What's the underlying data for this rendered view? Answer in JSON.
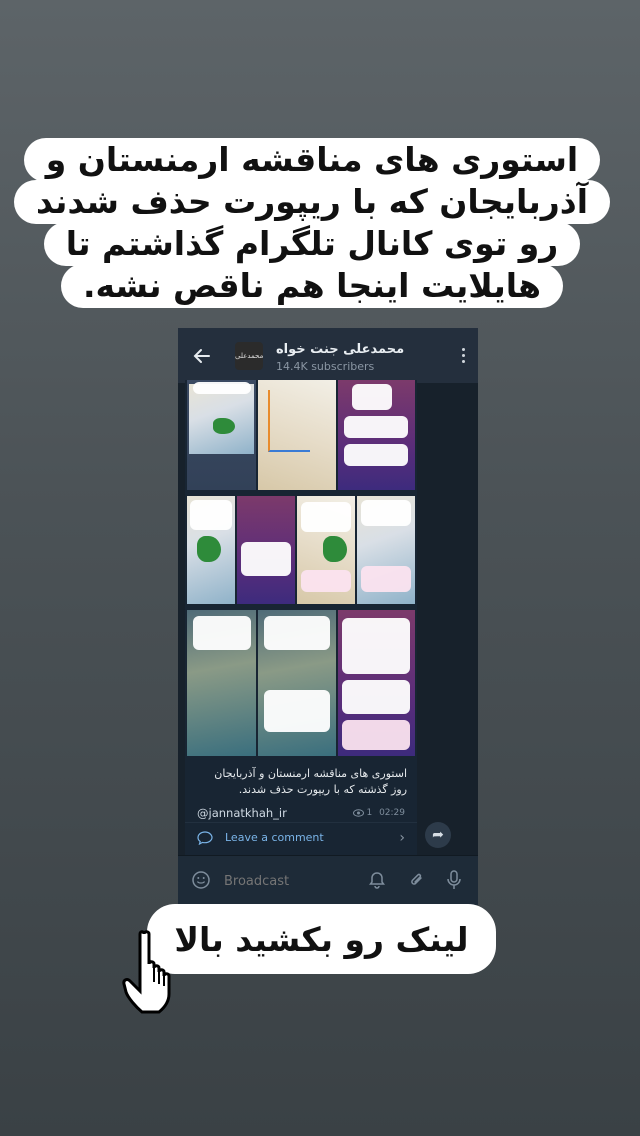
{
  "story": {
    "caption_lines": [
      "استوری های مناقشه ارمنستان و",
      "آذربایجان که با ریپورت حذف شدند",
      "رو توی کانال تلگرام گذاشتم تا",
      "هایلایت اینجا هم ناقص نشه."
    ],
    "swipe_up_label": "لینک رو بکشید بالا"
  },
  "telegram": {
    "channel_title": "محمدعلی جنت خواه",
    "subscribers": "14.4K subscribers",
    "avatar_text": "محمدعلی",
    "post_caption": "استوری های مناقشه ارمنستان و آذربایجان روز گذشته که با ریپورت حذف شدند.",
    "post_signature": "@jannatkhah_ir",
    "post_views": "1",
    "post_time": "02:29",
    "comment_label": "Leave a comment",
    "composer_placeholder": "Broadcast"
  },
  "colors": {
    "background": "#4b5256",
    "telegram_dark": "#17212b",
    "header": "#242f3d",
    "link_blue": "#7ab4e8"
  },
  "icons": [
    "back-arrow-icon",
    "more-vertical-icon",
    "eye-icon",
    "comment-icon",
    "chevron-right-icon",
    "share-icon",
    "emoji-icon",
    "bell-icon",
    "paperclip-icon",
    "mic-icon",
    "hand-cursor-icon"
  ]
}
